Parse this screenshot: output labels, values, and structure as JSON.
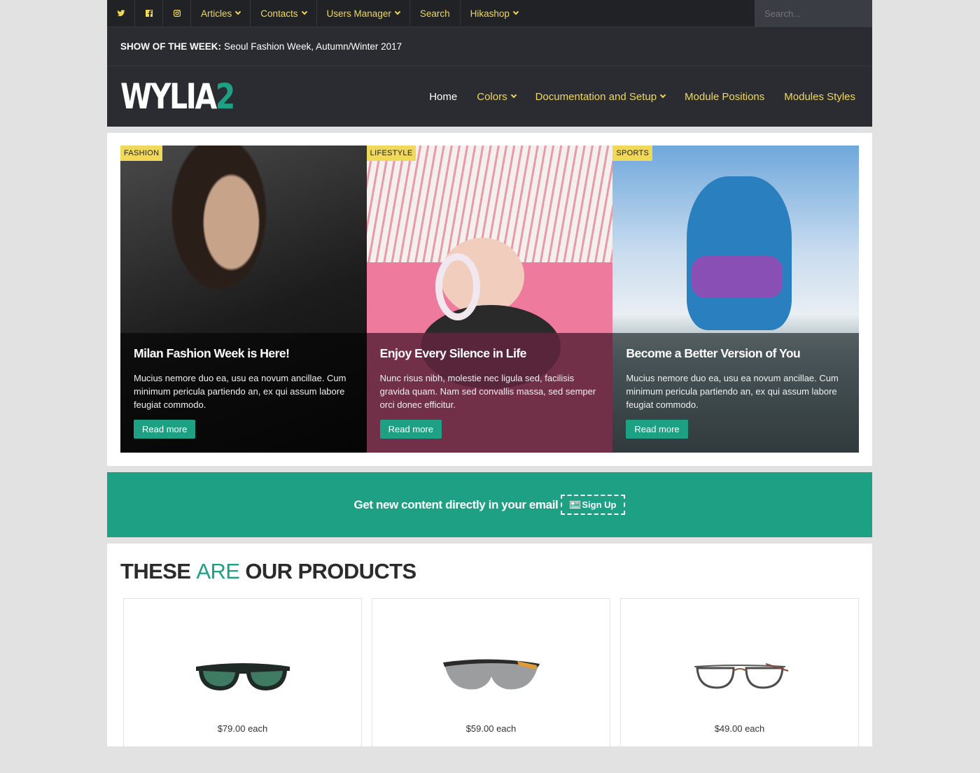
{
  "topbar": {
    "social": [
      "twitter-icon",
      "facebook-icon",
      "instagram-icon"
    ],
    "nav": [
      {
        "label": "Articles",
        "dropdown": true
      },
      {
        "label": "Contacts",
        "dropdown": true
      },
      {
        "label": "Users Manager",
        "dropdown": true
      },
      {
        "label": "Search",
        "dropdown": false
      },
      {
        "label": "Hikashop",
        "dropdown": true
      }
    ],
    "search_placeholder": "Search..."
  },
  "show": {
    "label": "SHOW OF THE WEEK:",
    "text": "Seoul Fashion Week, Autumn/Winter 2017"
  },
  "header": {
    "logo_main": "WYLIA",
    "logo_accent": "2",
    "nav": [
      {
        "label": "Home"
      },
      {
        "label": "Colors"
      },
      {
        "label": "Documentation and Setup"
      },
      {
        "label": "Module Positions"
      },
      {
        "label": "Modules Styles"
      }
    ]
  },
  "featured": [
    {
      "tag": "FASHION",
      "title": "Milan Fashion Week is Here!",
      "text": "Mucius nemore duo ea, usu ea novum ancillae. Cum minimum pericula partiendo an, ex qui assum labore feugiat commodo.",
      "button": "Read more"
    },
    {
      "tag": "LIFESTYLE",
      "title": "Enjoy Every Silence in Life",
      "text": "Nunc risus nibh, molestie nec ligula sed, facilisis gravida quam. Nam sed convallis massa, sed semper orci donec efficitur.",
      "button": "Read more"
    },
    {
      "tag": "SPORTS",
      "title": "Become a Better Version of You",
      "text": "Mucius nemore duo ea, usu ea novum ancillae. Cum minimum pericula partiendo an, ex qui assum labore feugiat commodo.",
      "button": "Read more"
    }
  ],
  "newsletter": {
    "text": "Get new content directly in your email",
    "button": "Sign Up"
  },
  "products": {
    "title_part1": "THESE",
    "title_highlight": "ARE",
    "title_part2": "OUR PRODUCTS",
    "items": [
      {
        "price": "$79.00 each"
      },
      {
        "price": "$59.00 each"
      },
      {
        "price": "$49.00 each"
      }
    ]
  },
  "colors": {
    "accent": "#1ea084",
    "yellow": "#f0d85a",
    "dark": "#2a2c31"
  }
}
